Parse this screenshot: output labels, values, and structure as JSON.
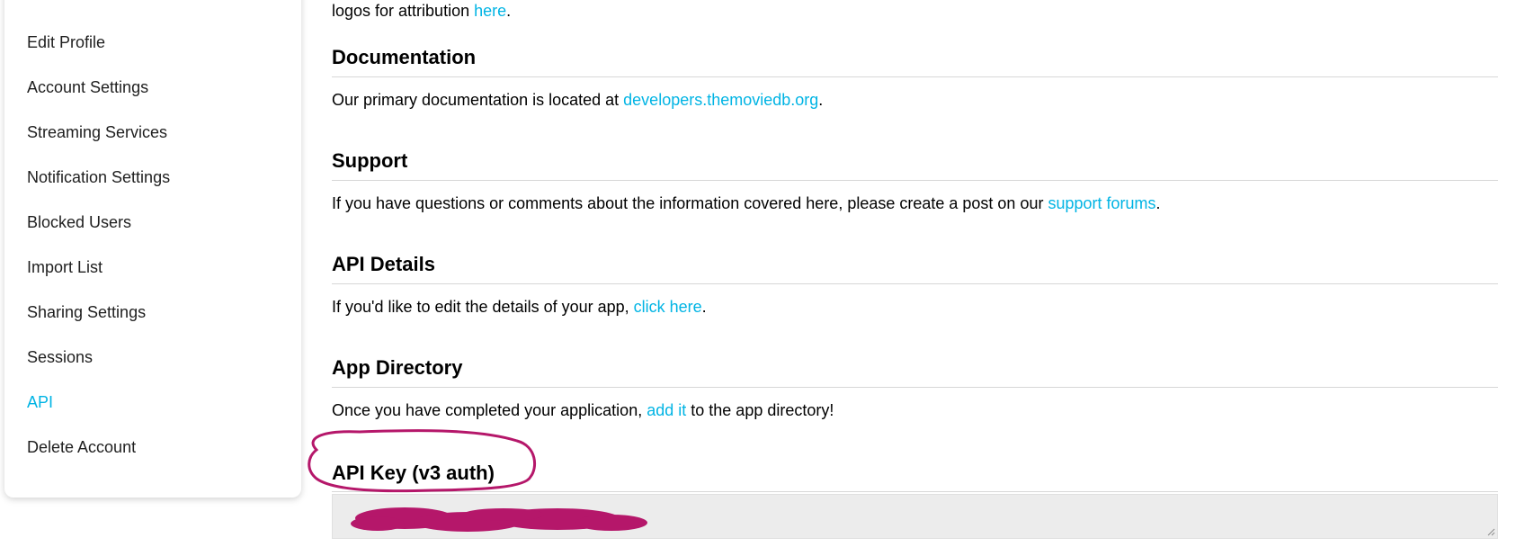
{
  "sidebar": {
    "items": [
      {
        "label": "Edit Profile",
        "active": false
      },
      {
        "label": "Account Settings",
        "active": false
      },
      {
        "label": "Streaming Services",
        "active": false
      },
      {
        "label": "Notification Settings",
        "active": false
      },
      {
        "label": "Blocked Users",
        "active": false
      },
      {
        "label": "Import List",
        "active": false
      },
      {
        "label": "Sharing Settings",
        "active": false
      },
      {
        "label": "Sessions",
        "active": false
      },
      {
        "label": "API",
        "active": true
      },
      {
        "label": "Delete Account",
        "active": false
      }
    ]
  },
  "top_partial": {
    "text_before": "logos for attribution ",
    "link": "here",
    "text_after": "."
  },
  "sections": {
    "documentation": {
      "title": "Documentation",
      "text_before": "Our primary documentation is located at ",
      "link": "developers.themoviedb.org",
      "text_after": "."
    },
    "support": {
      "title": "Support",
      "text_before": "If you have questions or comments about the information covered here, please create a post on our ",
      "link": "support forums",
      "text_after": "."
    },
    "api_details": {
      "title": "API Details",
      "text_before": "If you'd like to edit the details of your app, ",
      "link": "click here",
      "text_after": "."
    },
    "app_directory": {
      "title": "App Directory",
      "text_before": "Once you have completed your application, ",
      "link": "add it",
      "text_after": " to the app directory!"
    },
    "api_key": {
      "title": "API Key (v3 auth)"
    }
  },
  "colors": {
    "link": "#01b4e4",
    "annotation": "#b5176a"
  }
}
